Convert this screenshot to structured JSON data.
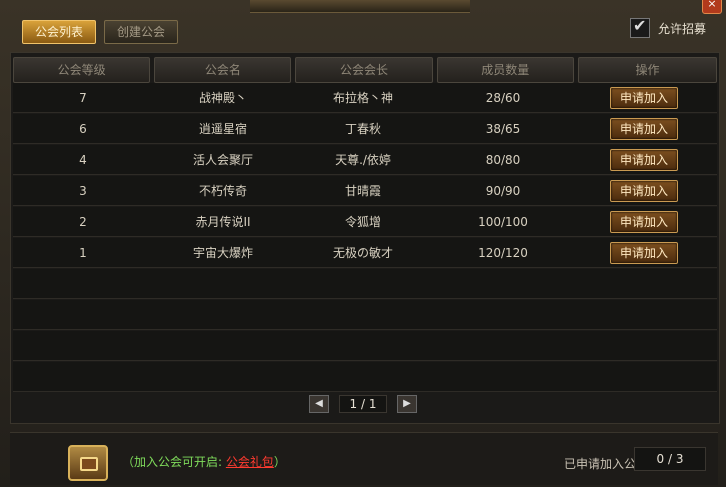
{
  "tabs": [
    {
      "label": "公会列表",
      "active": true
    },
    {
      "label": "创建公会",
      "active": false
    }
  ],
  "recruit": {
    "label": "允许招募",
    "checked": true
  },
  "table": {
    "headers": [
      "公会等级",
      "公会名",
      "公会会长",
      "成员数量",
      "操作"
    ],
    "rows": [
      {
        "level": "7",
        "name": "战神殿丶",
        "leader": "布拉格丶神",
        "members": "28/60",
        "action": "申请加入"
      },
      {
        "level": "6",
        "name": "逍遥星宿",
        "leader": "丁春秋",
        "members": "38/65",
        "action": "申请加入"
      },
      {
        "level": "4",
        "name": "活人会聚厅",
        "leader": "天尊./依婷",
        "members": "80/80",
        "action": "申请加入"
      },
      {
        "level": "3",
        "name": "不朽传奇",
        "leader": "甘晴霞",
        "members": "90/90",
        "action": "申请加入"
      },
      {
        "level": "2",
        "name": "赤月传说II",
        "leader": "令狐增",
        "members": "100/100",
        "action": "申请加入"
      },
      {
        "level": "1",
        "name": "宇宙大爆炸",
        "leader": "无极の敏才",
        "members": "120/120",
        "action": "申请加入"
      }
    ]
  },
  "pager": {
    "page": "1 / 1",
    "prev_icon": "arrow-left-icon",
    "next_icon": "arrow-right-icon"
  },
  "footer": {
    "gift_text": "（加入公会可开启: ",
    "gift_link": "公会礼包",
    "gift_end": "）",
    "applied_label": "已申请加入公会:",
    "applied_value": "0 / 3"
  },
  "colors": {
    "accent": "#d9a23a",
    "gift_text": "#7fdc5b",
    "gift_link": "#ff3b30"
  }
}
